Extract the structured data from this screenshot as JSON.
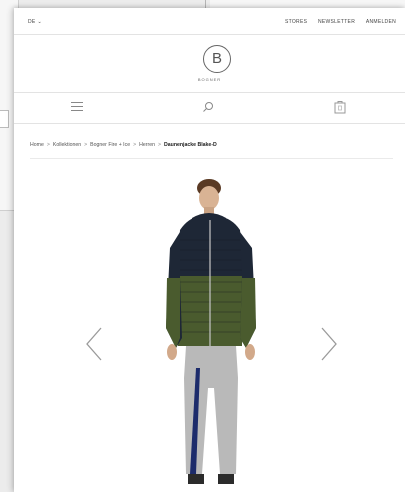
{
  "topbar": {
    "language": "DE",
    "links": [
      "STORES",
      "NEWSLETTER",
      "ANMELDEN"
    ]
  },
  "logo": {
    "letter": "B",
    "wordmark": "BOGNER"
  },
  "icons": {
    "menu": "hamburger-menu-icon",
    "search": "search-icon",
    "bag": "shopping-bag-icon",
    "prev": "chevron-left-icon",
    "next": "chevron-right-icon"
  },
  "breadcrumb": {
    "items": [
      "Home",
      "Kollektionen",
      "Bogner Fire + Ice",
      "Herren"
    ],
    "current": "Daunenjacke Blake-D",
    "separator": ">"
  },
  "colors": {
    "background": "#ececec",
    "page": "#ffffff",
    "divider": "#e3e3e3",
    "jacket_top": "#1e2736",
    "jacket_bottom": "#4a5b2e",
    "pants": "#b9b9b9"
  }
}
